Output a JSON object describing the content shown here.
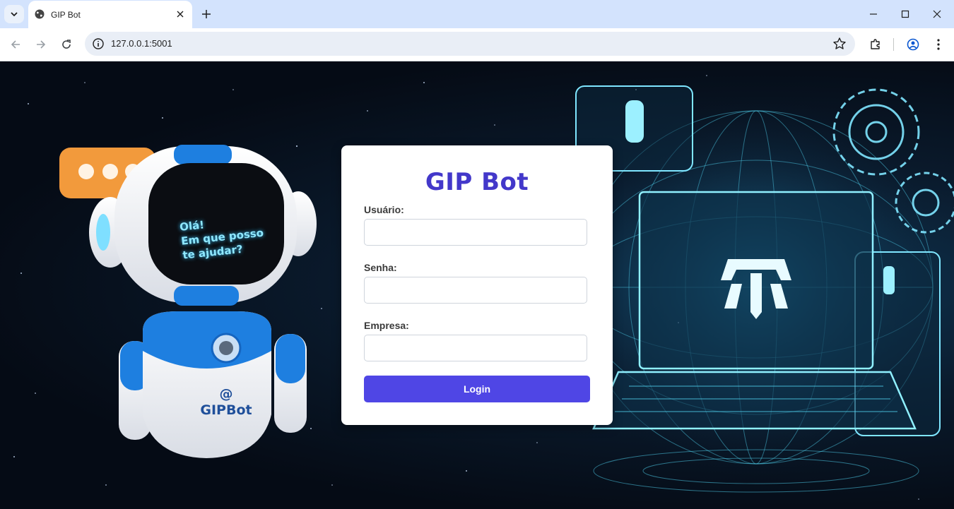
{
  "browser": {
    "tab_title": "GIP Bot",
    "url": "127.0.0.1:5001"
  },
  "login": {
    "title": "GIP Bot",
    "username_label": "Usuário:",
    "username_value": "",
    "password_label": "Senha:",
    "password_value": "",
    "company_label": "Empresa:",
    "company_value": "",
    "submit_label": "Login"
  },
  "robot": {
    "screen_line1": "Olá!",
    "screen_line2": "Em que posso",
    "screen_line3": "te ajudar?",
    "body_at": "@",
    "body_brand": "GIPBot"
  },
  "colors": {
    "accent": "#4f46e5",
    "title": "#4338ca",
    "chrome_tabstrip": "#d3e3fd",
    "robot_blue": "#1e7fe0",
    "bubble": "#f29a3c",
    "hologram": "#52d8f5"
  }
}
